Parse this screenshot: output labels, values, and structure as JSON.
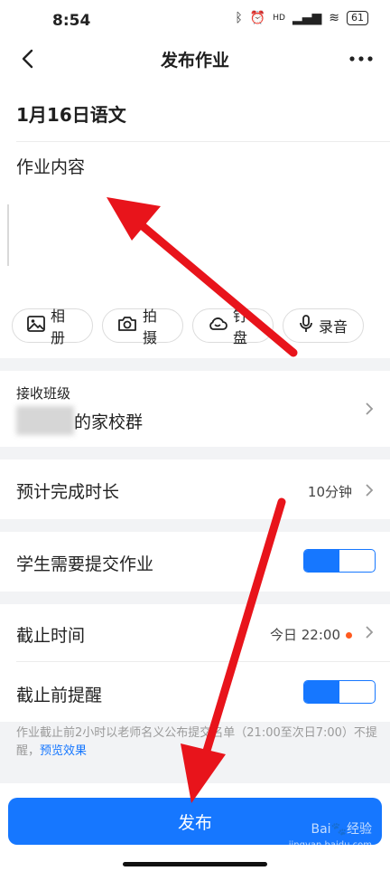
{
  "status": {
    "time": "8:54",
    "hd": "HD",
    "battery": "61"
  },
  "header": {
    "title": "发布作业"
  },
  "homework": {
    "title": "1月16日语文",
    "content_placeholder": "作业内容"
  },
  "media": [
    {
      "label": "相册",
      "icon": "image-icon"
    },
    {
      "label": "拍摄",
      "icon": "camera-icon"
    },
    {
      "label": "钉盘",
      "icon": "cloud-icon"
    },
    {
      "label": "录音",
      "icon": "mic-icon"
    }
  ],
  "receive": {
    "label": "接收班级",
    "class_suffix": "的家校群"
  },
  "duration": {
    "label": "预计完成时长",
    "value": "10分钟"
  },
  "submit": {
    "label": "学生需要提交作业",
    "enabled": true
  },
  "deadline": {
    "label": "截止时间",
    "value": "今日 22:00"
  },
  "remind": {
    "label": "截止前提醒",
    "enabled": true
  },
  "note": {
    "text": "作业截止前2小时以老师名义公布提交名单（21:00至次日7:00）不提醒，",
    "link": "预览效果"
  },
  "publish": {
    "label": "发布"
  },
  "watermark": {
    "brand": "Bai🐾经验",
    "url": "jingyan.baidu.com"
  },
  "colors": {
    "accent": "#1677ff",
    "arrow": "#e8141b",
    "dot": "#ff5a1f"
  }
}
